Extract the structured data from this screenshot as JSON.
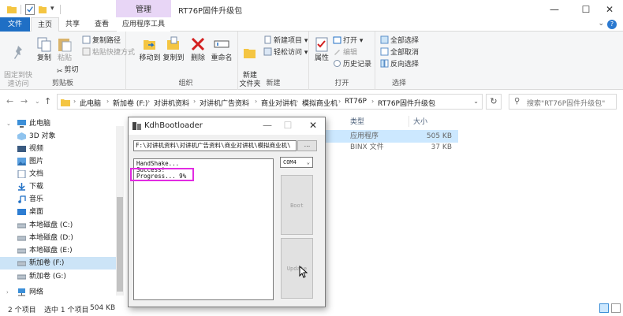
{
  "titlebar": {
    "context_tab": "管理",
    "title": "RT76P固件升级包"
  },
  "ribbon_tabs": {
    "file": "文件",
    "home": "主页",
    "share": "共享",
    "view": "查看",
    "app_tools": "应用程序工具"
  },
  "ribbon": {
    "clipboard": {
      "pin": "固定到快\n速访问",
      "copy": "复制",
      "paste": "粘贴",
      "copy_path": "复制路径",
      "paste_shortcut": "粘贴快捷方式",
      "cut": "剪切",
      "label": "剪贴板"
    },
    "organize": {
      "move_to": "移动到",
      "copy_to": "复制到",
      "delete": "删除",
      "rename": "重命名",
      "label": "组织"
    },
    "new": {
      "new_folder": "新建\n文件夹",
      "new_item": "新建项目",
      "easy_access": "轻松访问",
      "label": "新建"
    },
    "open": {
      "properties": "属性",
      "open": "打开",
      "edit": "编辑",
      "history": "历史记录",
      "label": "打开"
    },
    "select": {
      "select_all": "全部选择",
      "select_none": "全部取消",
      "invert": "反向选择",
      "label": "选择"
    }
  },
  "address_bar": {
    "crumbs": [
      "此电脑",
      "新加卷 (F:)",
      "对讲机资料",
      "对讲机广告资料",
      "商业对讲机",
      "模拟商业机",
      "RT76P",
      "RT76P固件升级包"
    ],
    "search_placeholder": "搜索\"RT76P固件升级包\""
  },
  "nav_pane": {
    "items": [
      {
        "label": "此电脑",
        "icon": "computer-icon"
      },
      {
        "label": "3D 对象",
        "icon": "cube-icon"
      },
      {
        "label": "视频",
        "icon": "video-icon"
      },
      {
        "label": "图片",
        "icon": "picture-icon"
      },
      {
        "label": "文档",
        "icon": "document-icon"
      },
      {
        "label": "下载",
        "icon": "download-icon"
      },
      {
        "label": "音乐",
        "icon": "music-icon"
      },
      {
        "label": "桌面",
        "icon": "desktop-icon"
      },
      {
        "label": "本地磁盘 (C:)",
        "icon": "drive-icon"
      },
      {
        "label": "本地磁盘 (D:)",
        "icon": "drive-icon"
      },
      {
        "label": "本地磁盘 (E:)",
        "icon": "drive-icon"
      },
      {
        "label": "新加卷 (F:)",
        "icon": "drive-icon"
      },
      {
        "label": "新加卷 (G:)",
        "icon": "drive-icon"
      },
      {
        "label": "网络",
        "icon": "network-icon"
      }
    ]
  },
  "file_list": {
    "columns": {
      "type": "类型",
      "size": "大小"
    },
    "rows": [
      {
        "type": "应用程序",
        "size": "505 KB"
      },
      {
        "type": "BINX 文件",
        "size": "37 KB"
      }
    ]
  },
  "status_bar": {
    "item_count": "2 个项目",
    "selection": "选中 1 个项目",
    "selection_size": "504 KB"
  },
  "dialog": {
    "title": "KdhBootloader",
    "path": "F:\\对讲机资料\\对讲机广告资料\\商业对讲机\\模拟商业机\\",
    "browse": "...",
    "log": [
      "HandShake...",
      "Success!",
      "Progress... 9%"
    ],
    "port": "COM4",
    "boot_label": "Boot",
    "update_label": "Update"
  },
  "colors": {
    "accent": "#1f6fc5",
    "manage_tab": "#e8d6f6",
    "highlight": "#e22be2",
    "selection": "#cce8ff"
  }
}
